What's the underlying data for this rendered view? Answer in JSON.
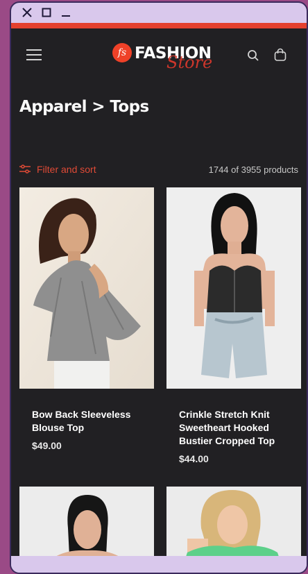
{
  "window": {
    "close_symbol": "✕",
    "max_symbol": "☐",
    "min_symbol": "—"
  },
  "header": {
    "logo_mark": "fs",
    "logo_word": "FASHION",
    "logo_script": "Store",
    "icons": [
      "menu-icon",
      "search-icon",
      "cart-icon"
    ]
  },
  "page": {
    "title": "Apparel > Tops"
  },
  "toolbar": {
    "filter_label": "Filter and sort",
    "count_text": "1744 of 3955 products"
  },
  "products": [
    {
      "title": "Bow Back Sleeveless Blouse Top",
      "price": "$49.00"
    },
    {
      "title": "Crinkle Stretch Knit Sweetheart Hooked Bustier Cropped Top",
      "price": "$44.00"
    }
  ],
  "colors": {
    "accent": "#e4402e",
    "background": "#212023",
    "frame": "#d9c8ec"
  }
}
